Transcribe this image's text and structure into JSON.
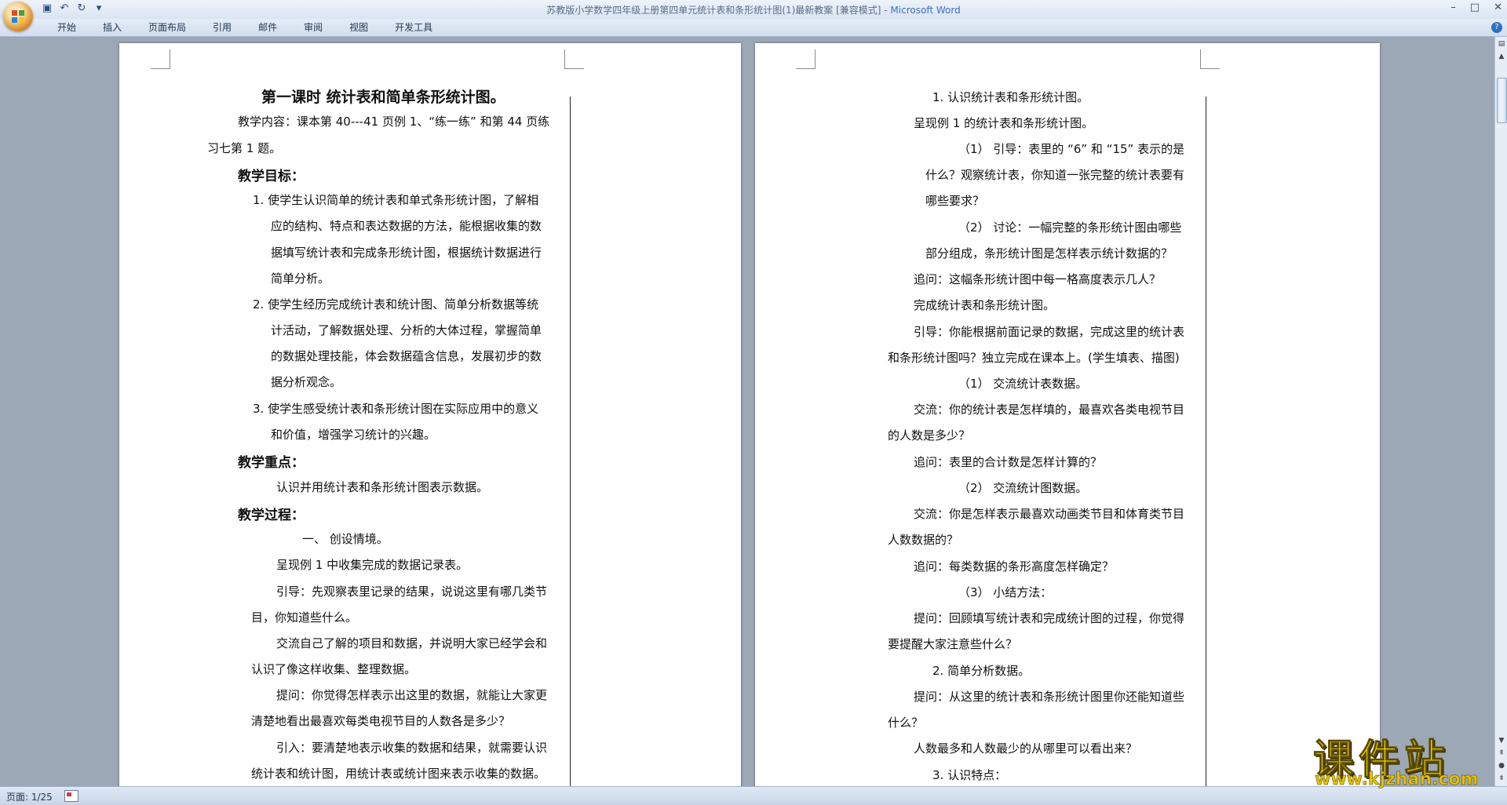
{
  "titlebar": {
    "title": "苏教版小学数学四年级上册第四单元统计表和条形统计图(1)最新教案 [兼容模式] - ",
    "app": "Microsoft Word"
  },
  "ribbon": {
    "tabs": [
      "开始",
      "插入",
      "页面布局",
      "引用",
      "邮件",
      "审阅",
      "视图",
      "开发工具"
    ]
  },
  "page1": {
    "lines": [
      "第一课时    统计表和简单条形统计图。",
      "教学内容：课本第 40---41 页例 1、“练一练” 和第 44 页练",
      "习七第 1 题。",
      "教学目标：",
      "1.  使学生认识简单的统计表和单式条形统计图，了解相",
      "应的结构、特点和表达数据的方法，能根据收集的数",
      "据填写统计表和完成条形统计图，根据统计数据进行",
      "简单分析。",
      "2.  使学生经历完成统计表和统计图、简单分析数据等统",
      "计活动，了解数据处理、分析的大体过程，掌握简单",
      "的数据处理技能，体会数据蕴含信息，发展初步的数",
      "据分析观念。",
      "3.  使学生感受统计表和条形统计图在实际应用中的意义",
      "和价值，增强学习统计的兴趣。",
      "教学重点：",
      "认识并用统计表和条形统计图表示数据。",
      "教学过程：",
      "一、    创设情境。",
      "呈现例 1 中收集完成的数据记录表。",
      "引导：先观察表里记录的结果，说说这里有哪几类节",
      "目，你知道些什么。",
      "交流自己了解的项目和数据，并说明大家已经学会和",
      "认识了像这样收集、整理数据。",
      "提问：你觉得怎样表示出这里的数据，就能让大家更",
      "清楚地看出最喜欢每类电视节目的人数各是多少？",
      "引入：要清楚地表示收集的数据和结果，就需要认识",
      "统计表和统计图，用统计表或统计图来表示收集的数据。"
    ]
  },
  "page2": {
    "lines": [
      "1.   认识统计表和条形统计图。",
      "呈现例 1 的统计表和条形统计图。",
      "（1）    引导：表里的 “6” 和 “15” 表示的是",
      "什么？观察统计表，你知道一张完整的统计表要有",
      "哪些要求？",
      "（2）    讨论：一幅完整的条形统计图由哪些",
      "部分组成，条形统计图是怎样表示统计数据的？",
      "追问：这幅条形统计图中每一格高度表示几人？",
      "完成统计表和条形统计图。",
      "引导：你能根据前面记录的数据，完成这里的统计表",
      "和条形统计图吗？独立完成在课本上。(学生填表、描图)",
      "（1）    交流统计表数据。",
      "交流：你的统计表是怎样填的，最喜欢各类电视节目",
      "的人数是多少？",
      "追问：表里的合计数是怎样计算的？",
      "（2）    交流统计图数据。",
      "交流：你是怎样表示最喜欢动画类节目和体育类节目",
      "人数数据的？",
      "追问：每类数据的条形高度怎样确定？",
      "（3）    小结方法：",
      "提问：回顾填写统计表和完成统计图的过程，你觉得",
      "要提醒大家注意些什么？",
      "2.   简单分析数据。",
      "提问：从这里的统计表和条形统计图里你还能知道些",
      "什么？",
      "人数最多和人数最少的从哪里可以看出来？",
      "3.   认识特点："
    ]
  },
  "status": {
    "page_label": "页面: 1/25"
  },
  "watermark": {
    "big": "课件站",
    "url": "www.kjzhan.com"
  }
}
